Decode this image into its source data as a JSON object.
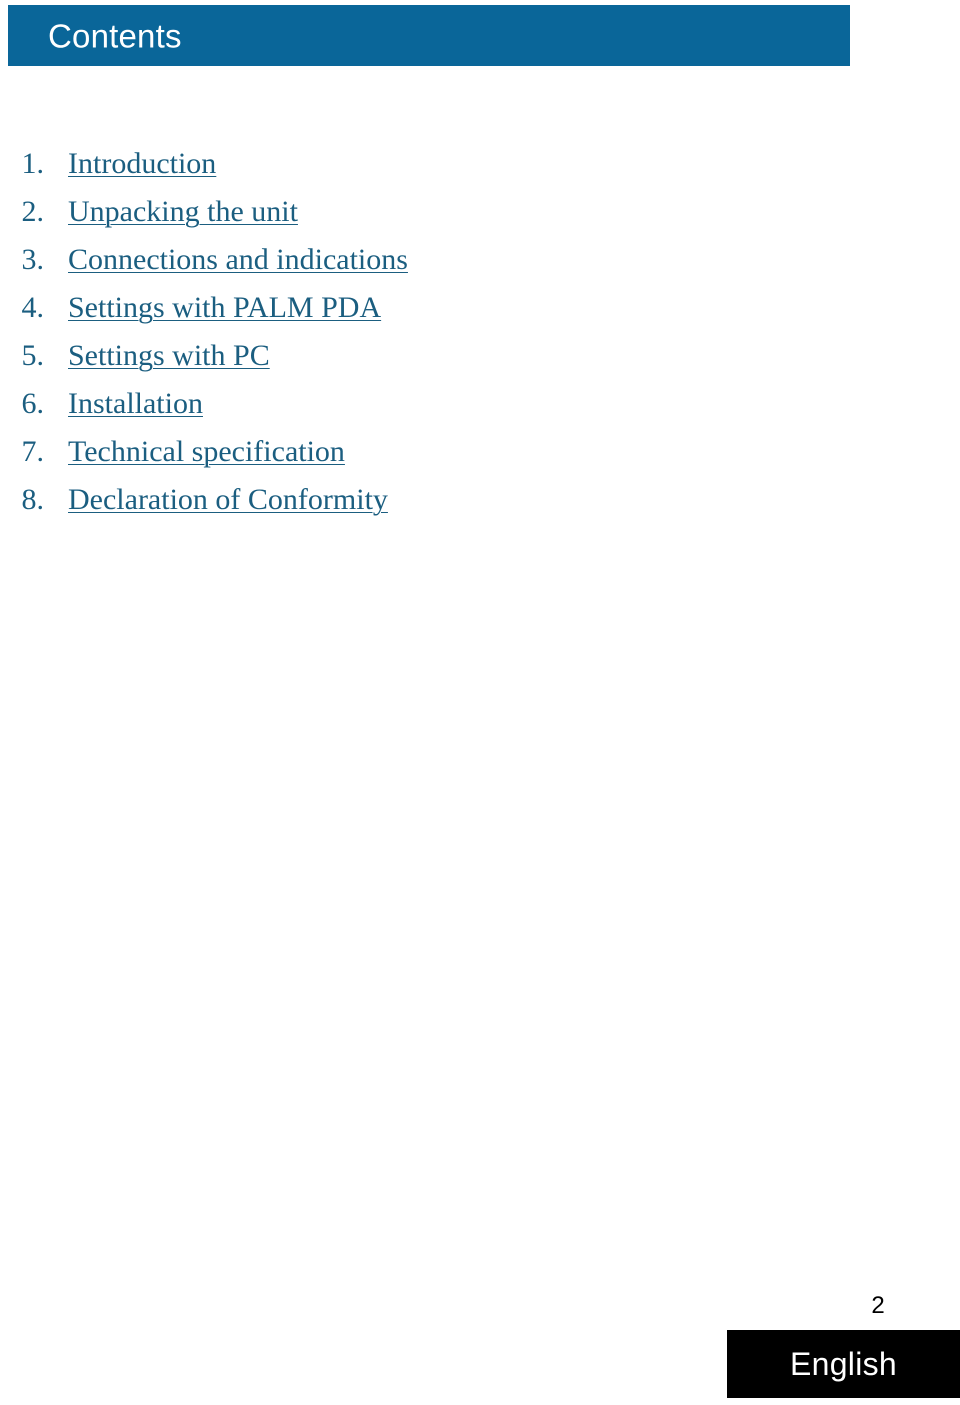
{
  "header": {
    "title": "Contents",
    "background_color": "#0A6699",
    "text_color": "#FFFFFF"
  },
  "toc": {
    "link_color": "#1B5E80",
    "items": [
      {
        "number": "1.",
        "label": "Introduction"
      },
      {
        "number": "2.",
        "label": "Unpacking the unit"
      },
      {
        "number": "3.",
        "label": "Connections and indications"
      },
      {
        "number": "4.",
        "label": "Settings with PALM PDA"
      },
      {
        "number": "5.",
        "label": "Settings with PC"
      },
      {
        "number": "6.",
        "label": "Installation"
      },
      {
        "number": "7.",
        "label": "Technical specification"
      },
      {
        "number": "8.",
        "label": "Declaration of Conformity"
      }
    ]
  },
  "footer": {
    "page_number": "2",
    "language": "English",
    "language_block_color": "#000000",
    "language_text_color": "#FFFFFF"
  }
}
